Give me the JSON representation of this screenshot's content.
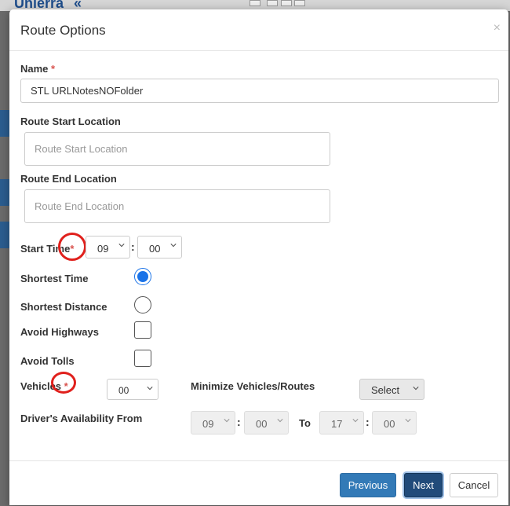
{
  "background": {
    "logo_text": "Unlerra"
  },
  "modal": {
    "title": "Route Options",
    "close_icon": "×"
  },
  "form": {
    "name": {
      "label": "Name",
      "required": "*",
      "value": "STL URLNotesNOFolder"
    },
    "start_location": {
      "label": "Route Start Location",
      "placeholder": "Route Start Location"
    },
    "end_location": {
      "label": "Route End Location",
      "placeholder": "Route End Location"
    },
    "start_time": {
      "label": "Start Time",
      "required": "*",
      "hour": "09",
      "separator": ":",
      "minute": "00"
    },
    "shortest_time": {
      "label": "Shortest Time",
      "selected": true
    },
    "shortest_distance": {
      "label": "Shortest Distance",
      "selected": false
    },
    "avoid_highways": {
      "label": "Avoid Highways",
      "checked": false
    },
    "avoid_tolls": {
      "label": "Avoid Tolls",
      "checked": false
    },
    "vehicles": {
      "label": "Vehicles",
      "required": "*",
      "value": "00"
    },
    "minimize": {
      "label": "Minimize Vehicles/Routes",
      "value": "Select"
    },
    "availability": {
      "label": "Driver's Availability From",
      "from_hour": "09",
      "from_minute": "00",
      "to_label": "To",
      "to_hour": "17",
      "to_minute": "00",
      "separator": ":"
    }
  },
  "footer": {
    "previous_label": "Previous",
    "next_label": "Next",
    "cancel_label": "Cancel"
  },
  "colors": {
    "primary": "#337ab7",
    "next": "#214b7a",
    "radio_on": "#1a73e8",
    "annotation": "#e0201c"
  }
}
